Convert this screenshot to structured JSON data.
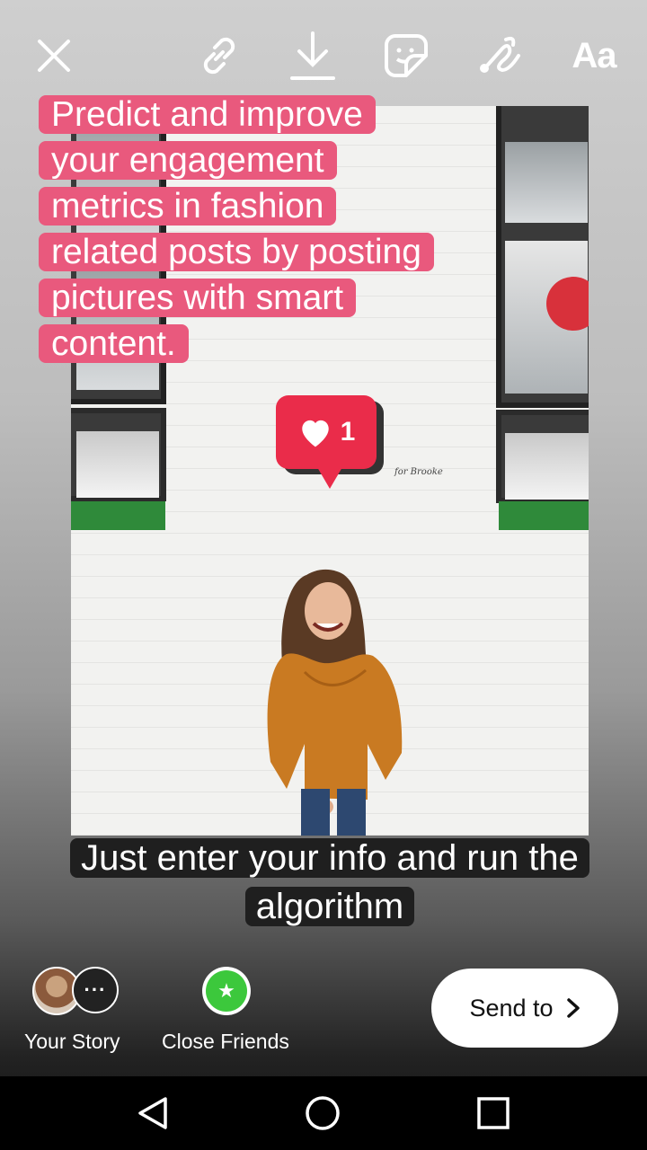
{
  "toolbar": {
    "close_icon": "close-icon",
    "link_icon": "link-icon",
    "download_icon": "download-icon",
    "sticker_icon": "sticker-icon",
    "draw_icon": "draw-icon",
    "text_tool_label": "Aa"
  },
  "photo": {
    "like_count": "1",
    "signature": "for Brooke"
  },
  "captions": {
    "top": "Predict and improve your engagement metrics in fashion related posts by posting pictures with smart content.",
    "bottom": "Just enter your info and run the algorithm"
  },
  "share": {
    "your_story_label": "Your Story",
    "more_label": "···",
    "close_friends_label": "Close Friends",
    "send_to_label": "Send to"
  },
  "colors": {
    "top_caption_bg": "#e9597d",
    "bottom_caption_bg": "#1f1f1f",
    "close_friends_green": "#3cc83c",
    "like_red": "#ea2c4a"
  },
  "navbar": {
    "back_icon": "back-triangle-icon",
    "home_icon": "home-circle-icon",
    "recents_icon": "recents-square-icon"
  }
}
